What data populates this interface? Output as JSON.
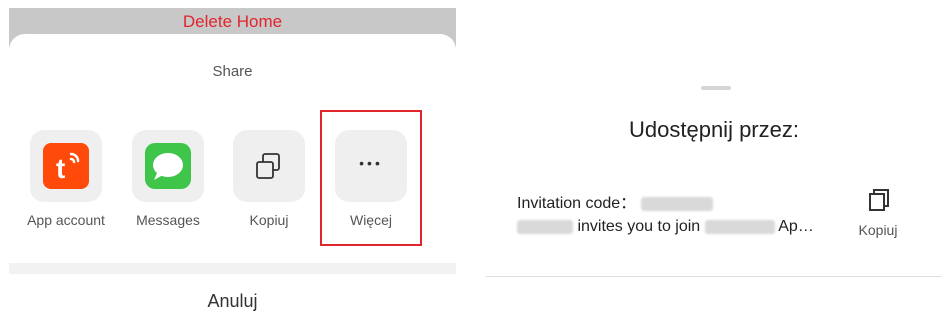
{
  "left_panel": {
    "delete_home": "Delete Home",
    "share_title": "Share",
    "tiles": [
      {
        "label": "App account",
        "icon": "tuya-app-icon"
      },
      {
        "label": "Messages",
        "icon": "messages-icon"
      },
      {
        "label": "Kopiuj",
        "icon": "copy-icon"
      },
      {
        "label": "Więcej",
        "icon": "more-icon"
      }
    ],
    "more_symbol": "•••",
    "cancel": "Anuluj"
  },
  "right_panel": {
    "title": "Udostępnij przez:",
    "invite_line1": "Invitation code：",
    "invite_line2a": "invites you to join",
    "invite_line2b": "Ap…",
    "copy_label": "Kopiuj"
  },
  "colors": {
    "accent_red": "#e0262c",
    "tuya_orange": "#ff4a0a",
    "messages_green": "#3ec54a"
  }
}
